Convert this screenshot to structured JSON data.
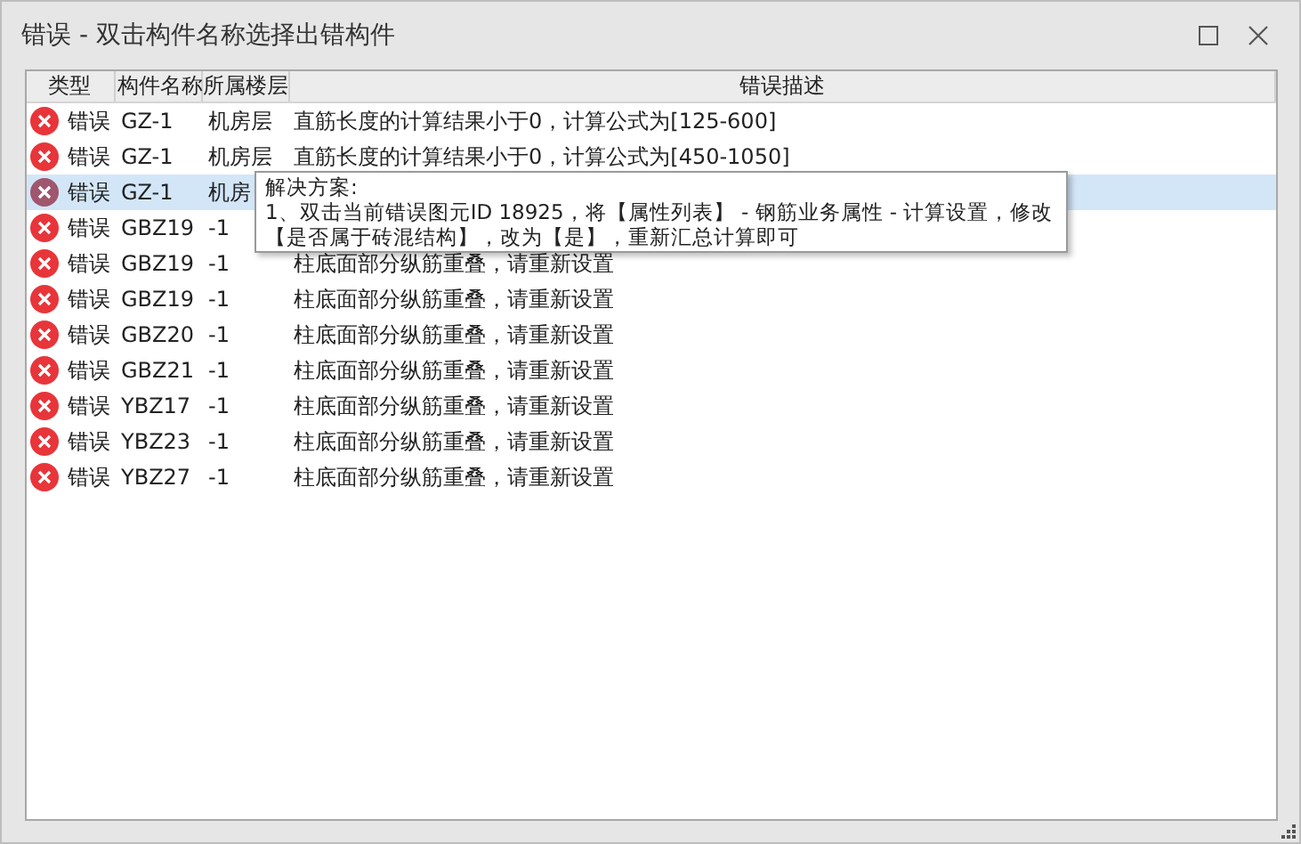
{
  "window": {
    "title": "错误 - 双击构件名称选择出错构件"
  },
  "table": {
    "columns": [
      "类型",
      "构件名称",
      "所属楼层",
      "错误描述"
    ],
    "rows": [
      {
        "type": "错误",
        "name": "GZ-1",
        "floor": "机房层",
        "desc": "直筋长度的计算结果小于0，计算公式为[125-600]",
        "selected": false
      },
      {
        "type": "错误",
        "name": "GZ-1",
        "floor": "机房层",
        "desc": "直筋长度的计算结果小于0，计算公式为[450-1050]",
        "selected": false
      },
      {
        "type": "错误",
        "name": "GZ-1",
        "floor": "机房",
        "selected": true
      },
      {
        "type": "错误",
        "name": "GBZ19",
        "floor": "-1",
        "selected": false
      },
      {
        "type": "错误",
        "name": "GBZ19",
        "floor": "-1",
        "desc": "柱底面部分纵筋重叠，请重新设置",
        "selected": false
      },
      {
        "type": "错误",
        "name": "GBZ19",
        "floor": "-1",
        "desc": "柱底面部分纵筋重叠，请重新设置",
        "selected": false
      },
      {
        "type": "错误",
        "name": "GBZ20",
        "floor": "-1",
        "desc": "柱底面部分纵筋重叠，请重新设置",
        "selected": false
      },
      {
        "type": "错误",
        "name": "GBZ21",
        "floor": "-1",
        "desc": "柱底面部分纵筋重叠，请重新设置",
        "selected": false
      },
      {
        "type": "错误",
        "name": "YBZ17",
        "floor": "-1",
        "desc": "柱底面部分纵筋重叠，请重新设置",
        "selected": false
      },
      {
        "type": "错误",
        "name": "YBZ23",
        "floor": "-1",
        "desc": "柱底面部分纵筋重叠，请重新设置",
        "selected": false
      },
      {
        "type": "错误",
        "name": "YBZ27",
        "floor": "-1",
        "desc": "柱底面部分纵筋重叠，请重新设置",
        "selected": false
      }
    ]
  },
  "tooltip": {
    "title": "解决方案:",
    "lines": [
      "1、双击当前错误图元ID 18925，将【属性列表】 - 钢筋业务属性 - 计算设置，修改",
      "【是否属于砖混结构】，改为【是】，重新汇总计算即可"
    ]
  }
}
